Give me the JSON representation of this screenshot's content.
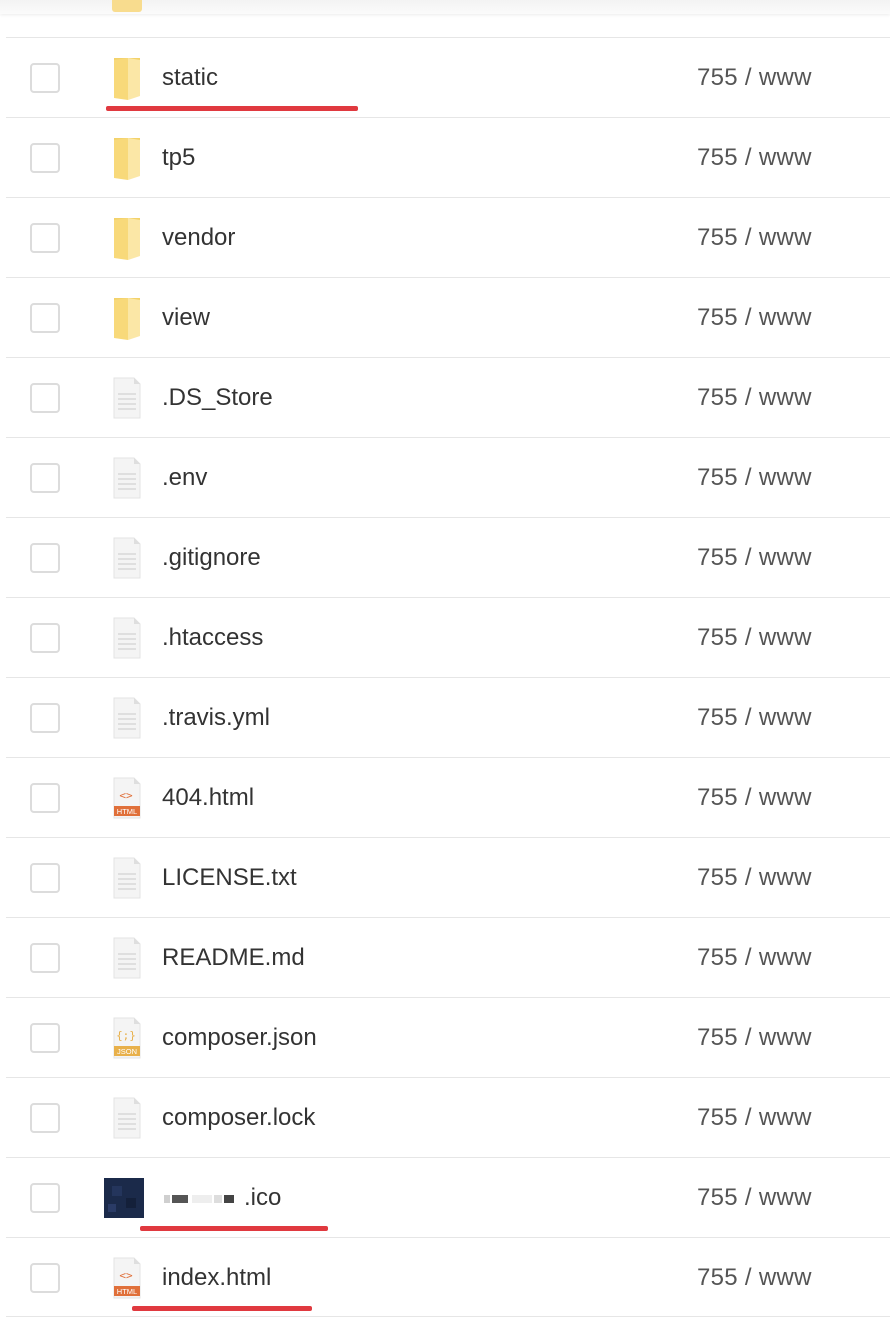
{
  "files": [
    {
      "name": "static",
      "type": "folder",
      "permission": "755",
      "owner": "www",
      "highlighted": true
    },
    {
      "name": "tp5",
      "type": "folder",
      "permission": "755",
      "owner": "www"
    },
    {
      "name": "vendor",
      "type": "folder",
      "permission": "755",
      "owner": "www"
    },
    {
      "name": "view",
      "type": "folder",
      "permission": "755",
      "owner": "www"
    },
    {
      "name": ".DS_Store",
      "type": "file",
      "permission": "755",
      "owner": "www"
    },
    {
      "name": ".env",
      "type": "file",
      "permission": "755",
      "owner": "www"
    },
    {
      "name": ".gitignore",
      "type": "file",
      "permission": "755",
      "owner": "www"
    },
    {
      "name": ".htaccess",
      "type": "file",
      "permission": "755",
      "owner": "www"
    },
    {
      "name": ".travis.yml",
      "type": "file",
      "permission": "755",
      "owner": "www"
    },
    {
      "name": "404.html",
      "type": "html",
      "permission": "755",
      "owner": "www"
    },
    {
      "name": "LICENSE.txt",
      "type": "file",
      "permission": "755",
      "owner": "www"
    },
    {
      "name": "README.md",
      "type": "file",
      "permission": "755",
      "owner": "www"
    },
    {
      "name": "composer.json",
      "type": "json",
      "permission": "755",
      "owner": "www"
    },
    {
      "name": "composer.lock",
      "type": "file",
      "permission": "755",
      "owner": "www"
    },
    {
      "name": ".ico",
      "type": "image",
      "permission": "755",
      "owner": "www",
      "highlighted": true,
      "name_partially_redacted": true
    },
    {
      "name": "index.html",
      "type": "html",
      "permission": "755",
      "owner": "www",
      "highlighted": true
    }
  ],
  "icon_labels": {
    "html": "HTML",
    "json": "JSON",
    "html_glyph": "<>",
    "json_glyph": "{;}"
  },
  "colors": {
    "folder": "#f8d97a",
    "html": "#e0703a",
    "json": "#e8b04a",
    "highlight": "#e0393f"
  }
}
